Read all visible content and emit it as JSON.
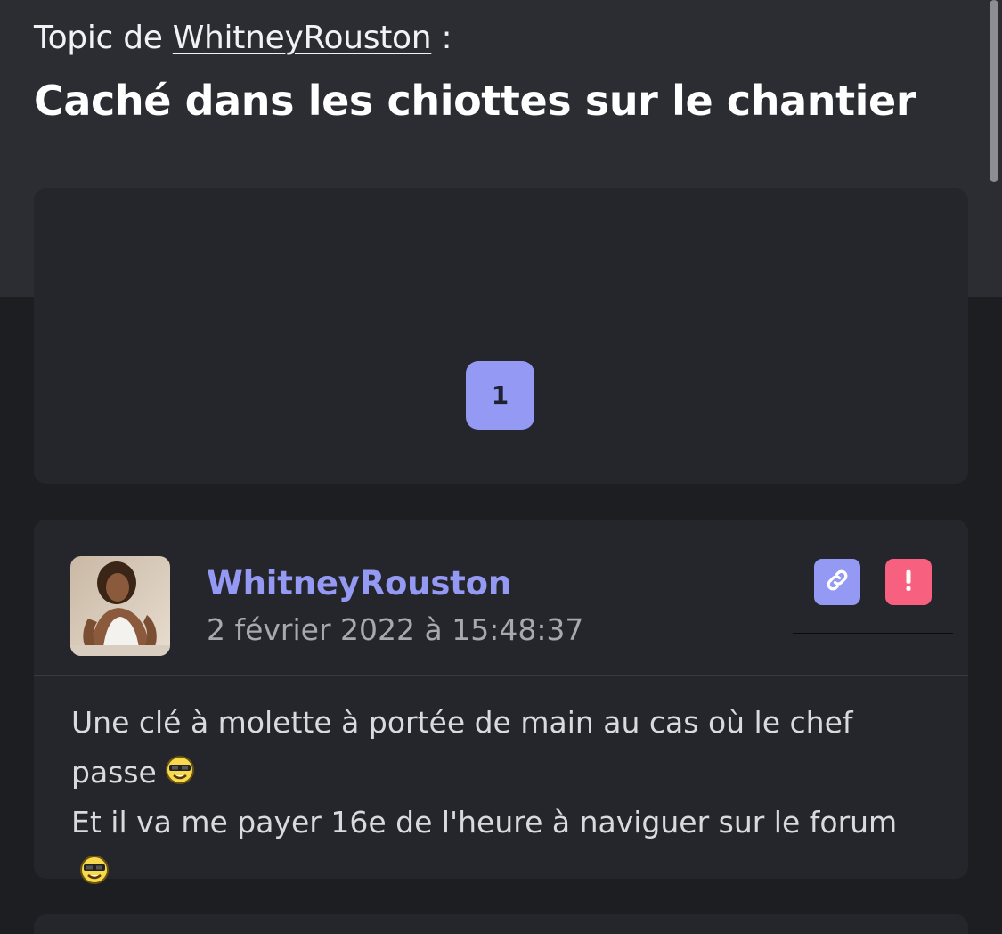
{
  "topic": {
    "prefix": "Topic de",
    "author": "WhitneyRouston",
    "suffix": ":",
    "title": "Caché dans les chiottes sur le chantier"
  },
  "pagination": {
    "pages": [
      "1"
    ],
    "current": "1"
  },
  "post": {
    "author": "WhitneyRouston",
    "date": "2 février 2022 à 15:48:37",
    "lines": [
      "Une clé à molette à portée de main au cas où le chef passe",
      "Et il va me payer 16e de l'heure à naviguer sur le forum"
    ],
    "actions": {
      "link_icon": "link-icon",
      "report_icon": "exclamation-icon"
    }
  },
  "colors": {
    "accent": "#9499f4",
    "report": "#f7607e",
    "background": "#1d1e22",
    "header_background": "#2c2d33",
    "card_background": "#25262b"
  }
}
